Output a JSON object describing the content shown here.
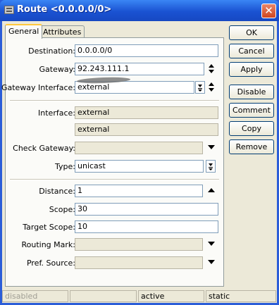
{
  "window": {
    "title": "Route <0.0.0.0/0>",
    "close_glyph": "✕"
  },
  "tabs": [
    {
      "label": "General",
      "active": true
    },
    {
      "label": "Attributes",
      "active": false
    }
  ],
  "fields": {
    "destination": {
      "label": "Destination:",
      "value": "0.0.0.0/0"
    },
    "gateway": {
      "label": "Gateway:",
      "value": "92.243.111.1"
    },
    "gateway_interface": {
      "label": "Gateway Interface:",
      "value": "external"
    },
    "interface": {
      "label": "Interface:",
      "value": "external"
    },
    "interface2": {
      "value": "external"
    },
    "check_gateway": {
      "label": "Check Gateway:",
      "value": ""
    },
    "type": {
      "label": "Type:",
      "value": "unicast"
    },
    "distance": {
      "label": "Distance:",
      "value": "1"
    },
    "scope": {
      "label": "Scope:",
      "value": "30"
    },
    "target_scope": {
      "label": "Target Scope:",
      "value": "10"
    },
    "routing_mark": {
      "label": "Routing Mark:",
      "value": ""
    },
    "pref_source": {
      "label": "Pref. Source:",
      "value": ""
    }
  },
  "buttons": {
    "ok": "OK",
    "cancel": "Cancel",
    "apply": "Apply",
    "disable": "Disable",
    "comment": "Comment",
    "copy": "Copy",
    "remove": "Remove"
  },
  "status": {
    "enabled": "disabled",
    "blank": "",
    "active": "active",
    "static": "static"
  },
  "colors": {
    "title_bar": "#1a52d2",
    "close_button": "#d0461f",
    "face": "#ece9d8"
  }
}
